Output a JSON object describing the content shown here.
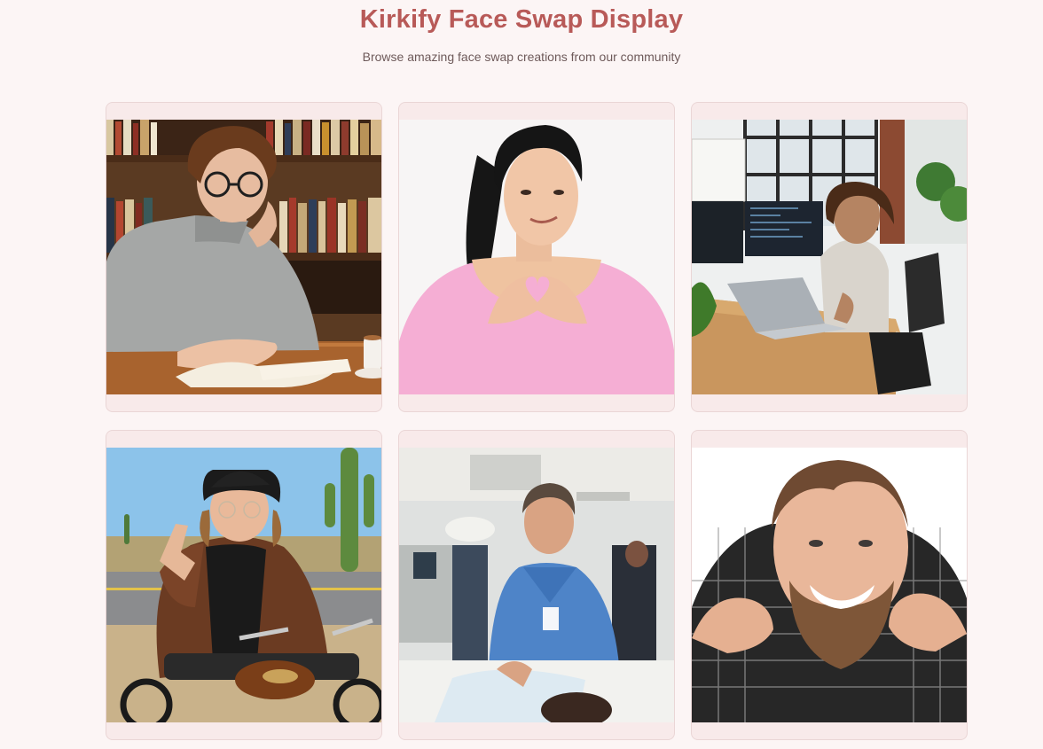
{
  "header": {
    "title": "Kirkify Face Swap Display",
    "subtitle": "Browse amazing face swap creations from our community"
  },
  "gallery": {
    "items": [
      {
        "scene": "library-reader"
      },
      {
        "scene": "heart-hands-pink"
      },
      {
        "scene": "office-laptop"
      },
      {
        "scene": "biker-desert"
      },
      {
        "scene": "hospital-nurse"
      },
      {
        "scene": "bearded-smile"
      }
    ]
  }
}
